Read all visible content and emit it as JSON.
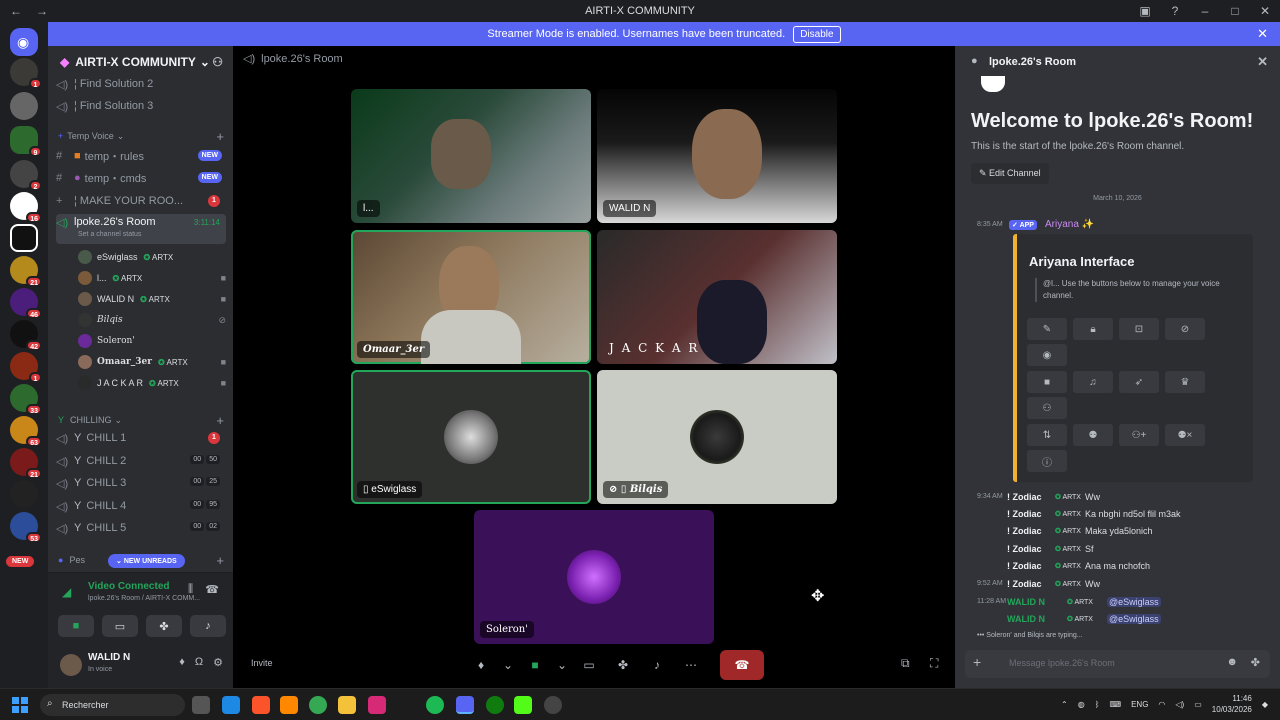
{
  "window": {
    "title": "AIRTI-X COMMUNITY"
  },
  "banner": {
    "text": "Streamer Mode is enabled. Usernames have been truncated.",
    "button": "Disable"
  },
  "server_badges": [
    "1",
    "9",
    "2",
    "16",
    "21",
    "46",
    "42",
    "1",
    "33",
    "63",
    "21",
    "53"
  ],
  "sidebar": {
    "server_name": "AIRTI-X COMMUNITY",
    "channels_top": [
      {
        "label": "¦ Find Solution 2"
      },
      {
        "label": "¦ Find Solution 3"
      }
    ],
    "temp_category": "Temp Voice",
    "temp_channels": [
      {
        "label": "temp・rules",
        "badge": "NEW"
      },
      {
        "label": "temp・cmds",
        "badge": "NEW"
      },
      {
        "label": "¦ MAKE YOUR ROO...",
        "badge": "1"
      }
    ],
    "active_channel": {
      "label": "lpoke.26's Room",
      "timer": "3:11:14",
      "status": "Set a channel status"
    },
    "members": [
      {
        "name": "eSwiglass",
        "tag": "ARTX"
      },
      {
        "name": "l...",
        "tag": "ARTX"
      },
      {
        "name": "WALID N",
        "tag": "ARTX"
      },
      {
        "name": "Bilqis",
        "tag": ""
      },
      {
        "name": "Soleron'",
        "tag": ""
      },
      {
        "name": "Omaar_3er",
        "tag": "ARTX"
      },
      {
        "name": "J A C K A R",
        "tag": "ARTX"
      }
    ],
    "chill_category": "CHILLING",
    "chill_channels": [
      {
        "label": "CHILL 1",
        "a": "",
        "b": "",
        "badge": "1"
      },
      {
        "label": "CHILL 2",
        "a": "00",
        "b": "50",
        "badge": ""
      },
      {
        "label": "CHILL 3",
        "a": "00",
        "b": "25",
        "badge": ""
      },
      {
        "label": "CHILL 4",
        "a": "00",
        "b": "95",
        "badge": ""
      },
      {
        "label": "CHILL 5",
        "a": "00",
        "b": "02",
        "badge": ""
      }
    ],
    "pes_category": "Pes",
    "new_unreads": "NEW UNREADS",
    "new_label": "NEW"
  },
  "voice": {
    "status": "Video Connected",
    "location": "lpoke.26's Room / AIRTI-X COMM..."
  },
  "user": {
    "name": "WALID N",
    "status": "In voice"
  },
  "stage": {
    "title": "lpoke.26's Room",
    "tiles": [
      {
        "name": "l..."
      },
      {
        "name": "WALID N"
      },
      {
        "name": "Omaar_3er"
      },
      {
        "name": "J A C K A R"
      },
      {
        "name": "eSwiglass"
      },
      {
        "name": "Bilqis"
      },
      {
        "name": "Soleron'"
      }
    ],
    "invite": "Invite"
  },
  "panel": {
    "title": "lpoke.26's Room",
    "welcome": "Welcome to lpoke.26's Room!",
    "subtitle": "This is the start of the lpoke.26's Room channel.",
    "edit": "Edit Channel",
    "date": "March 10, 2026",
    "bot_time": "8:35 AM",
    "app_badge": "APP",
    "bot_name": "Ariyana",
    "embed_title": "Ariyana Interface",
    "embed_desc": "@l... Use the buttons below to manage your voice channel.",
    "messages": [
      {
        "time": "9:34 AM",
        "author": "! Zodiac",
        "tag": "ARTX",
        "text": "Ww"
      },
      {
        "time": "",
        "author": "! Zodiac",
        "tag": "ARTX",
        "text": "Ka nbghi nd5ol flil m3ak"
      },
      {
        "time": "",
        "author": "! Zodiac",
        "tag": "ARTX",
        "text": "Maka yda5lonich"
      },
      {
        "time": "",
        "author": "! Zodiac",
        "tag": "ARTX",
        "text": "Sf"
      },
      {
        "time": "",
        "author": "! Zodiac",
        "tag": "ARTX",
        "text": "Ana ma nchofch"
      },
      {
        "time": "9:52 AM",
        "author": "! Zodiac",
        "tag": "ARTX",
        "text": "Ww"
      },
      {
        "time": "11:28 AM",
        "author": "WALID N",
        "tag": "ARTX",
        "text": "@eSwiglass"
      },
      {
        "time": "",
        "author": "WALID N",
        "tag": "ARTX",
        "text": "@eSwiglass"
      }
    ],
    "typing": "Soleron' and Bilqis are typing...",
    "placeholder": "Message lpoke.26's Room"
  },
  "taskbar": {
    "search": "Rechercher",
    "lang": "ENG",
    "time": "11:46",
    "date": "10/03/2026"
  }
}
